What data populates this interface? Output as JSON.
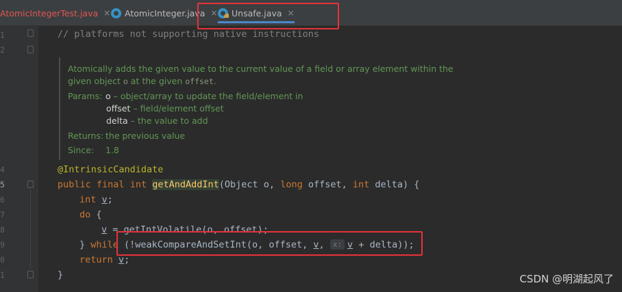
{
  "tabs": [
    {
      "label": "AtomicIntegerTest.java",
      "close": "×"
    },
    {
      "label": "AtomicInteger.java",
      "close": "×"
    },
    {
      "label": "Unsafe.java",
      "close": "×"
    }
  ],
  "gutter": {
    "line_numbers": [
      "1",
      "2",
      "4",
      "5",
      "6",
      "7",
      "8",
      "9",
      "0",
      "1"
    ]
  },
  "code": {
    "comment_line": "// platforms not supporting native instructions",
    "annotation": "@IntrinsicCandidate",
    "sig_public": "public",
    "sig_final": "final",
    "sig_int": "int",
    "sig_method": "getAndAddInt",
    "sig_open": "(Object o, ",
    "sig_long": "long",
    "sig_offset": " offset, ",
    "sig_int2": "int",
    "sig_rest": " delta) {",
    "line_int": "int",
    "line_v_decl": "v",
    "line_semicolon": ";",
    "line_do": "do",
    "line_do_brace": " {",
    "line_assign_v": "v",
    "line_assign_rest": " = getIntVolatile(o, offset);",
    "line_while_brace": "} ",
    "line_while_kw": "while",
    "line_while_call": " (!weakCompareAndSetInt(o, offset, ",
    "line_while_v": "v",
    "line_while_comma": ", ",
    "param_hint": "x:",
    "line_while_v2": "v",
    "line_while_end": " + delta));",
    "line_return_kw": "return",
    "line_return_v": "v",
    "line_return_end": ";",
    "closing_brace": "}"
  },
  "doc": {
    "desc_part1": "Atomically adds the given value to the current value of a field or array element within the given object ",
    "desc_o": "o",
    "desc_part2": " at the given ",
    "desc_offset": "offset",
    "desc_end": ".",
    "params_key": "Params:",
    "param1_name": "o",
    "param1_desc": " – object/array to update the field/element in",
    "param2_name": "offset",
    "param2_desc": " – field/element offset",
    "param3_name": "delta",
    "param3_desc": " – the value to add",
    "returns_key": "Returns:",
    "returns_val": "the previous value",
    "since_key": "Since:",
    "since_val": "1.8"
  },
  "watermark": "CSDN @明湖起风了",
  "colors": {
    "annotation_red": "#e8323a",
    "active_tab_underline": "#4a88c7",
    "keyword": "#cc7832",
    "method": "#ffc66d",
    "doc_text": "#629755"
  }
}
